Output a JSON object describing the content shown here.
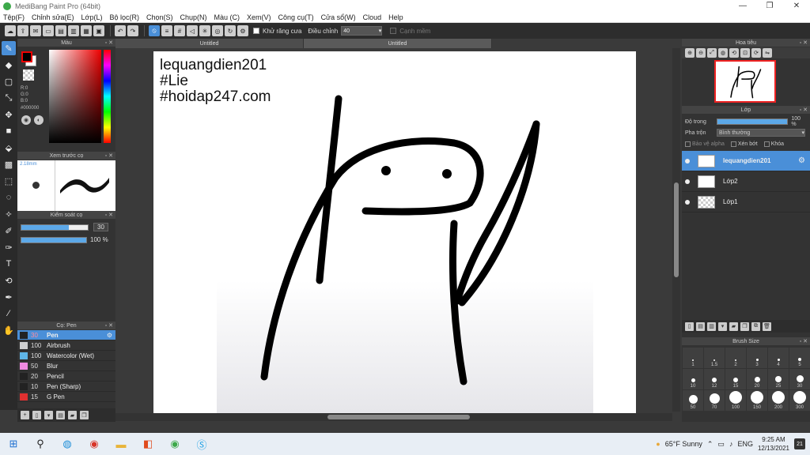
{
  "window": {
    "title": "MediBang Paint Pro (64bit)"
  },
  "menu": [
    "Tệp(F)",
    "Chỉnh sửa(E)",
    "Lớp(L)",
    "Bộ lọc(R)",
    "Chọn(S)",
    "Chụp(N)",
    "Màu (C)",
    "Xem(V)",
    "Công cụ(T)",
    "Cửa sổ(W)",
    "Cloud",
    "Help"
  ],
  "toolbar": {
    "antialias_label": "Khử răng cưa",
    "adjust_label": "Điều chỉnh",
    "adjust_value": "40",
    "soft_edge_label": "Cạnh mềm"
  },
  "color_panel": {
    "title": "Màu",
    "r": "R:0",
    "g": "G:0",
    "b": "B:0",
    "hex": "#000000",
    "fg_color": "#000000"
  },
  "brush_preview": {
    "title": "Xem trước cọ",
    "size": "2.18mm"
  },
  "brush_control": {
    "title": "Kiểm soát cọ",
    "size_value": "30",
    "size_fraction": 0.72,
    "opacity_value": "100 %",
    "opacity_fraction": 1.0
  },
  "brush_list": {
    "title": "Cọ: Pen",
    "items": [
      {
        "size": "30",
        "name": "Pen",
        "color": "#222222"
      },
      {
        "size": "100",
        "name": "Airbrush",
        "color": "#cfcfcf"
      },
      {
        "size": "100",
        "name": "Watercolor (Wet)",
        "color": "#5fb6e8"
      },
      {
        "size": "50",
        "name": "Blur",
        "color": "#f08ae0"
      },
      {
        "size": "20",
        "name": "Pencil",
        "color": "#222222"
      },
      {
        "size": "10",
        "name": "Pen (Sharp)",
        "color": "#222222"
      },
      {
        "size": "15",
        "name": "G Pen",
        "color": "#e03030"
      }
    ]
  },
  "doc_tabs": [
    "Untitled",
    "Untitled"
  ],
  "canvas_text": {
    "line1": "lequangdien201",
    "line2": "#Lie",
    "line3": "#hoidap247.com"
  },
  "navigator": {
    "title": "Hoa tiêu"
  },
  "layer_panel": {
    "title": "Lớp",
    "opacity_label": "Độ trong",
    "opacity_value": "100 %",
    "blend_label": "Pha trộn",
    "blend_value": "Bình thường",
    "protect_alpha": "Bảo vệ alpha",
    "clip": "Xén bớt",
    "lock": "Khóa",
    "layers": [
      {
        "name": "lequangdien201",
        "active": true
      },
      {
        "name": "Lớp2",
        "active": false
      },
      {
        "name": "Lớp1",
        "active": false
      }
    ]
  },
  "brush_size_panel": {
    "title": "Brush Size",
    "sizes": [
      "1",
      "1.5",
      "2",
      "3",
      "4",
      "5",
      "10",
      "12",
      "15",
      "20",
      "25",
      "30",
      "50",
      "70",
      "100",
      "150",
      "200",
      "300"
    ]
  },
  "taskbar": {
    "weather": "65°F Sunny",
    "lang": "ENG",
    "time": "9:25 AM",
    "date": "12/13/2021",
    "notifications": "21"
  },
  "accent_color": "#4a8fd8"
}
